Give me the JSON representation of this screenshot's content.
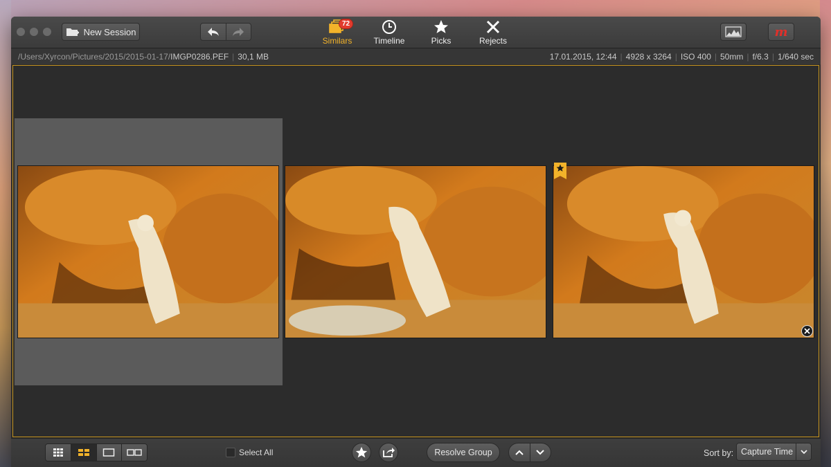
{
  "toolbar": {
    "new_session_label": "New Session",
    "modes": [
      {
        "label": "Similars",
        "badge": "72",
        "icon": "stack-icon"
      },
      {
        "label": "Timeline",
        "icon": "clock-icon"
      },
      {
        "label": "Picks",
        "icon": "star-icon"
      },
      {
        "label": "Rejects",
        "icon": "x-icon"
      }
    ],
    "brand_glyph": "m"
  },
  "info": {
    "path_dim": "/Users/Xyrcon/Pictures/2015/2015-01-17/",
    "filename": "IMGP0286.PEF",
    "filesize": "30,1 MB",
    "datetime": "17.01.2015, 12:44",
    "dimensions": "4928 x 3264",
    "iso": "ISO 400",
    "focal": "50mm",
    "aperture": "f/6.3",
    "shutter": "1/640 sec"
  },
  "colors": {
    "accent": "#f3b32a",
    "badge": "#e23b2e",
    "stage_border": "#c7951f"
  },
  "footer": {
    "select_all_label": "Select All",
    "resolve_label": "Resolve Group",
    "sort_label": "Sort by:",
    "sort_value": "Capture Time"
  }
}
